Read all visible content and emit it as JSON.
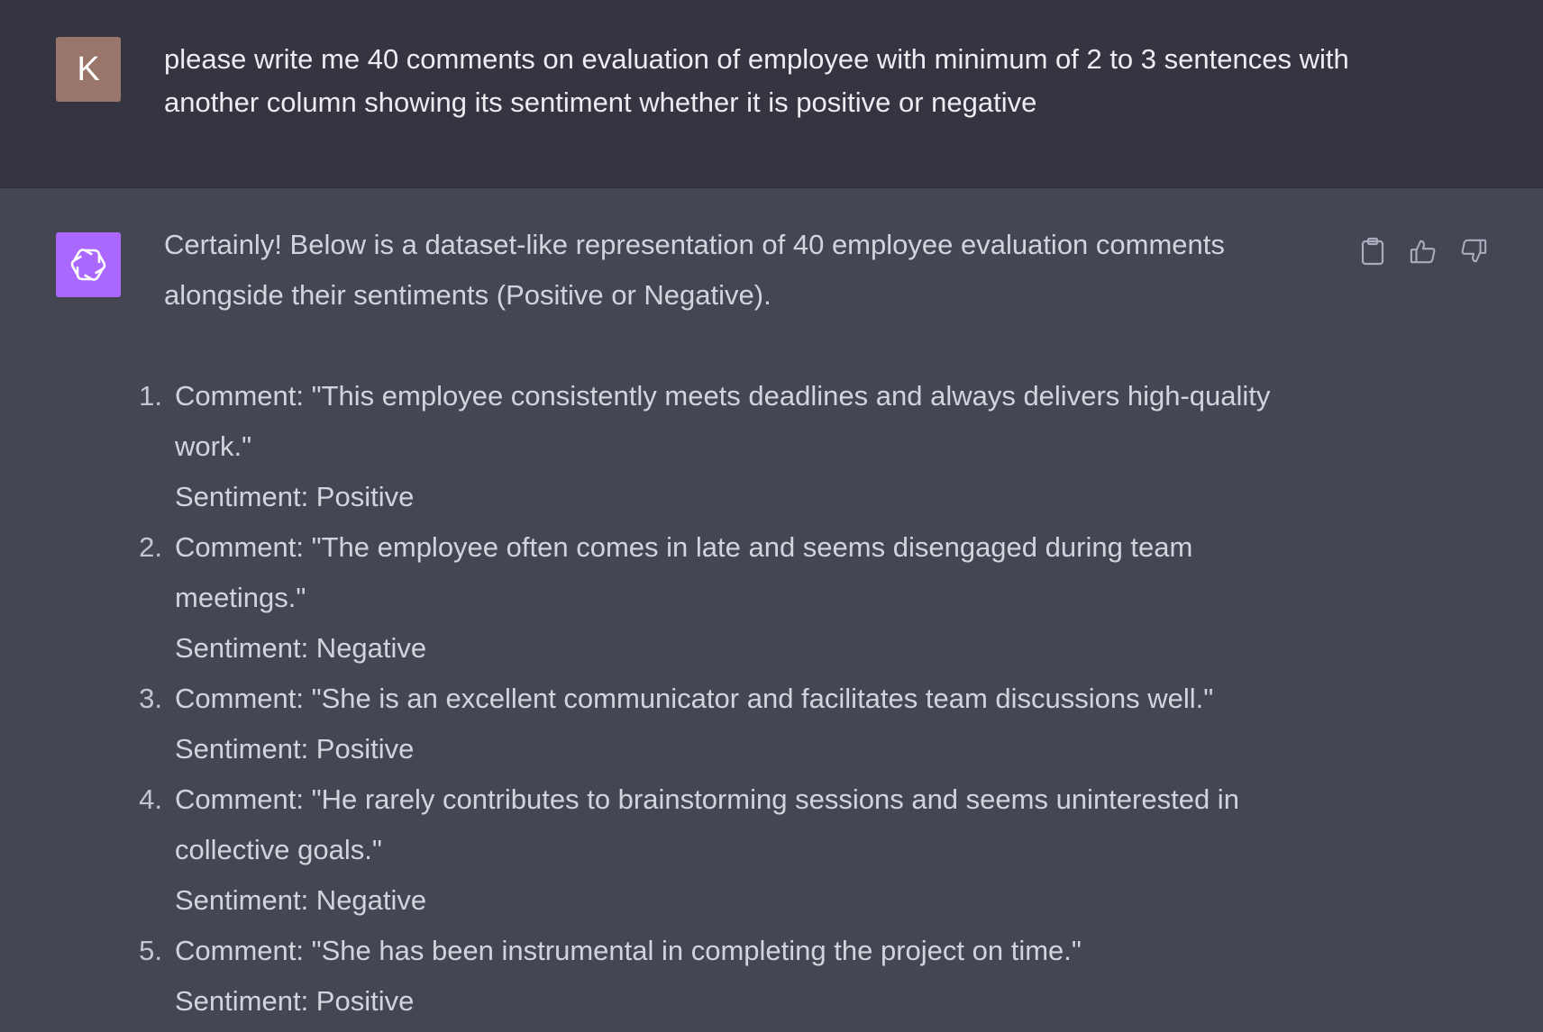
{
  "user": {
    "avatar_letter": "K",
    "message": "please write me 40 comments on evaluation of employee with minimum of 2 to 3 sentences with another column showing its sentiment whether it is positive or negative"
  },
  "assistant": {
    "intro": "Certainly! Below is a dataset-like representation of 40 employee evaluation comments alongside their sentiments (Positive or Negative).",
    "items": [
      {
        "num": "1.",
        "comment": "Comment: \"This employee consistently meets deadlines and always delivers high-quality work.\"",
        "sentiment": "Sentiment: Positive"
      },
      {
        "num": "2.",
        "comment": "Comment: \"The employee often comes in late and seems disengaged during team meetings.\"",
        "sentiment": "Sentiment: Negative"
      },
      {
        "num": "3.",
        "comment": "Comment: \"She is an excellent communicator and facilitates team discussions well.\"",
        "sentiment": "Sentiment: Positive"
      },
      {
        "num": "4.",
        "comment": "Comment: \"He rarely contributes to brainstorming sessions and seems uninterested in collective goals.\"",
        "sentiment": "Sentiment: Negative"
      },
      {
        "num": "5.",
        "comment": "Comment: \"She has been instrumental in completing the project on time.\"",
        "sentiment": "Sentiment: Positive"
      }
    ]
  },
  "icons": {
    "copy": "clipboard-icon",
    "thumbs_up": "thumbs-up-icon",
    "thumbs_down": "thumbs-down-icon",
    "bot_logo": "openai-logo-icon"
  },
  "colors": {
    "user_bg": "#343541",
    "assistant_bg": "#444654",
    "user_avatar": "#9a7569",
    "bot_avatar": "#ab68ff"
  }
}
